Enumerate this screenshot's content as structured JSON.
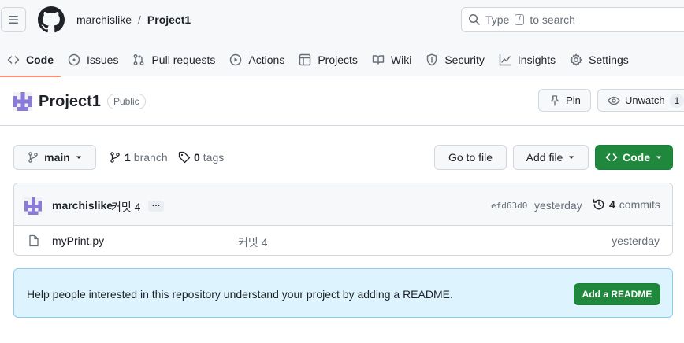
{
  "header": {
    "owner": "marchislike",
    "separator": "/",
    "repo": "Project1",
    "search_placeholder_before": "Type",
    "search_key": "/",
    "search_placeholder_after": "to search"
  },
  "tabs": [
    {
      "label": "Code",
      "icon": "code-icon",
      "active": true
    },
    {
      "label": "Issues",
      "icon": "issue-icon"
    },
    {
      "label": "Pull requests",
      "icon": "pull-request-icon"
    },
    {
      "label": "Actions",
      "icon": "play-icon"
    },
    {
      "label": "Projects",
      "icon": "table-icon"
    },
    {
      "label": "Wiki",
      "icon": "book-icon"
    },
    {
      "label": "Security",
      "icon": "shield-icon"
    },
    {
      "label": "Insights",
      "icon": "graph-icon"
    },
    {
      "label": "Settings",
      "icon": "gear-icon"
    }
  ],
  "repo_header": {
    "name": "Project1",
    "visibility": "Public",
    "pin_label": "Pin",
    "unwatch_label": "Unwatch",
    "watch_count": "1"
  },
  "branch_bar": {
    "branch": "main",
    "branch_count": "1",
    "branch_label": "branch",
    "tag_count": "0",
    "tag_label": "tags",
    "go_to_file": "Go to file",
    "add_file": "Add file",
    "code": "Code"
  },
  "latest_commit": {
    "author": "marchislike",
    "message": "커밋 4",
    "ellipsis": "…",
    "sha": "efd63d0",
    "time": "yesterday",
    "commit_count": "4",
    "commit_label": "commits"
  },
  "files": [
    {
      "name": "myPrint.py",
      "message": "커밋 4",
      "time": "yesterday"
    }
  ],
  "readme_banner": {
    "text": "Help people interested in this repository understand your project by adding a README.",
    "button": "Add a README"
  },
  "colors": {
    "accent_green": "#1f883d",
    "tab_underline": "#fd8c73",
    "banner_bg": "#ddf4ff",
    "identicon": "#8a7ad9"
  }
}
